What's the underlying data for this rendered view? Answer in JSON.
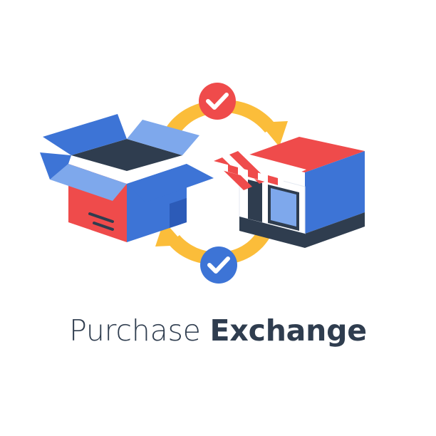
{
  "caption": {
    "light_text": "Purchase",
    "bold_text": "Exchange"
  },
  "colors": {
    "blue": "#3d74d6",
    "blue_dark": "#2c5bb8",
    "blue_light": "#7ea8ec",
    "red": "#ef4b4b",
    "yellow": "#fbbd3a",
    "navy": "#2f3d4f",
    "white": "#ffffff"
  },
  "icons": {
    "box": "open-box-icon",
    "store": "storefront-icon",
    "cycle": "exchange-arrows-icon",
    "check": "checkmark-icon"
  }
}
